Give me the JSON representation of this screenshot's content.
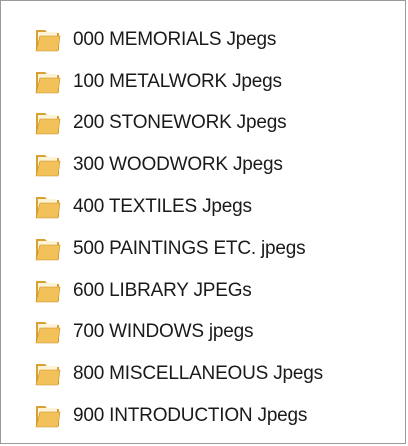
{
  "folders": [
    {
      "name": "000 MEMORIALS Jpegs",
      "icon": "folder-icon"
    },
    {
      "name": "100 METALWORK Jpegs",
      "icon": "folder-icon"
    },
    {
      "name": "200 STONEWORK Jpegs",
      "icon": "folder-icon"
    },
    {
      "name": "300 WOODWORK Jpegs",
      "icon": "folder-icon"
    },
    {
      "name": "400 TEXTILES Jpegs",
      "icon": "folder-icon"
    },
    {
      "name": "500 PAINTINGS ETC. jpegs",
      "icon": "folder-icon"
    },
    {
      "name": "600 LIBRARY JPEGs",
      "icon": "folder-icon"
    },
    {
      "name": "700 WINDOWS jpegs",
      "icon": "folder-icon"
    },
    {
      "name": "800 MISCELLANEOUS Jpegs",
      "icon": "folder-icon"
    },
    {
      "name": "900 INTRODUCTION Jpegs",
      "icon": "folder-icon"
    }
  ],
  "colors": {
    "folder_front": "#f2c15a",
    "folder_back": "#d9a032",
    "folder_paper": "#fdf3d6",
    "text": "#1a1a1a"
  }
}
